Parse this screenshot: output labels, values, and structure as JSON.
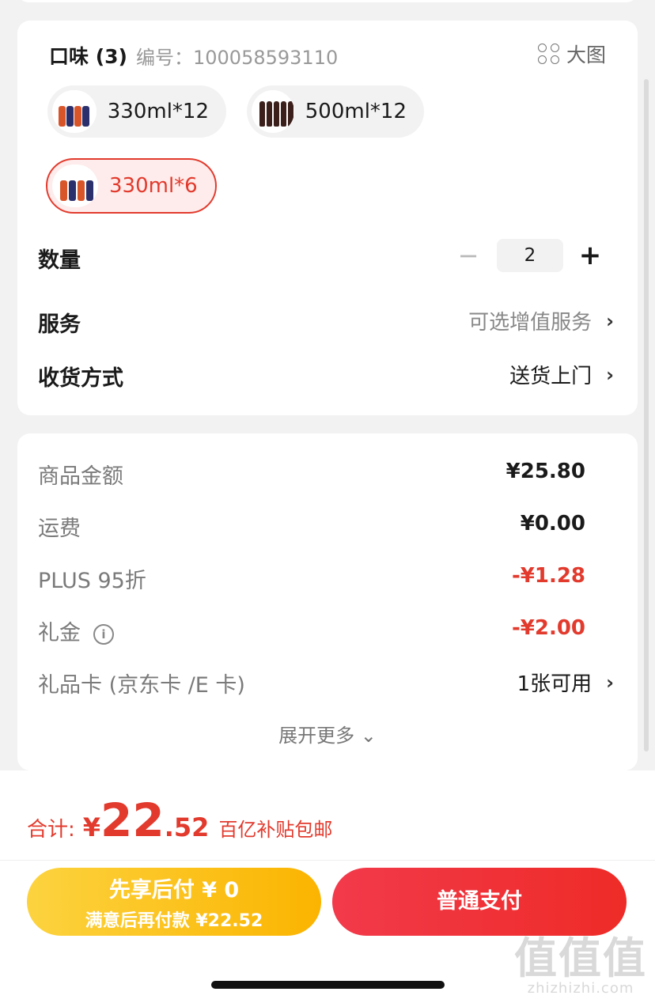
{
  "spec": {
    "flavor_title": "口味 (3)",
    "sku_label": "编号：100058593110",
    "big_image_label": "大图",
    "options": [
      {
        "label": "330ml*12",
        "selected": false
      },
      {
        "label": "500ml*12",
        "selected": false
      },
      {
        "label": "330ml*6",
        "selected": true
      }
    ],
    "quantity": {
      "label": "数量",
      "minus": "−",
      "value": "2",
      "plus": "+"
    },
    "service": {
      "label": "服务",
      "value": "可选增值服务",
      "chevron": "›"
    },
    "delivery": {
      "label": "收货方式",
      "value": "送货上门",
      "chevron": "›"
    }
  },
  "price": {
    "rows": [
      {
        "label": "商品金额",
        "value": "¥25.80"
      },
      {
        "label": "运费",
        "value": "¥0.00"
      },
      {
        "label": "PLUS 95折",
        "value": "-¥1.28"
      },
      {
        "label": "礼金",
        "value": "-¥2.00"
      },
      {
        "label": "礼品卡 (京东卡 /E 卡)",
        "value": "1张可用"
      }
    ],
    "info_glyph": "i",
    "expand_label": "展开更多 ⌄"
  },
  "summary": {
    "total_label": "合计:",
    "currency": "¥",
    "amount_int": "22",
    "amount_dec": ".52",
    "tag": "百亿补贴包邮"
  },
  "actions": {
    "pay_later_line1": "先享后付 ¥ 0",
    "pay_later_line2": "满意后再付款 ¥22.52",
    "normal_pay": "普通支付"
  },
  "watermark": {
    "logo": "值值值",
    "domain": "zhizhizhi.com"
  },
  "colors": {
    "accent_red": "#e23a2d",
    "pay_later_yellow": "#fbb400",
    "pay_red": "#ee2b27"
  }
}
